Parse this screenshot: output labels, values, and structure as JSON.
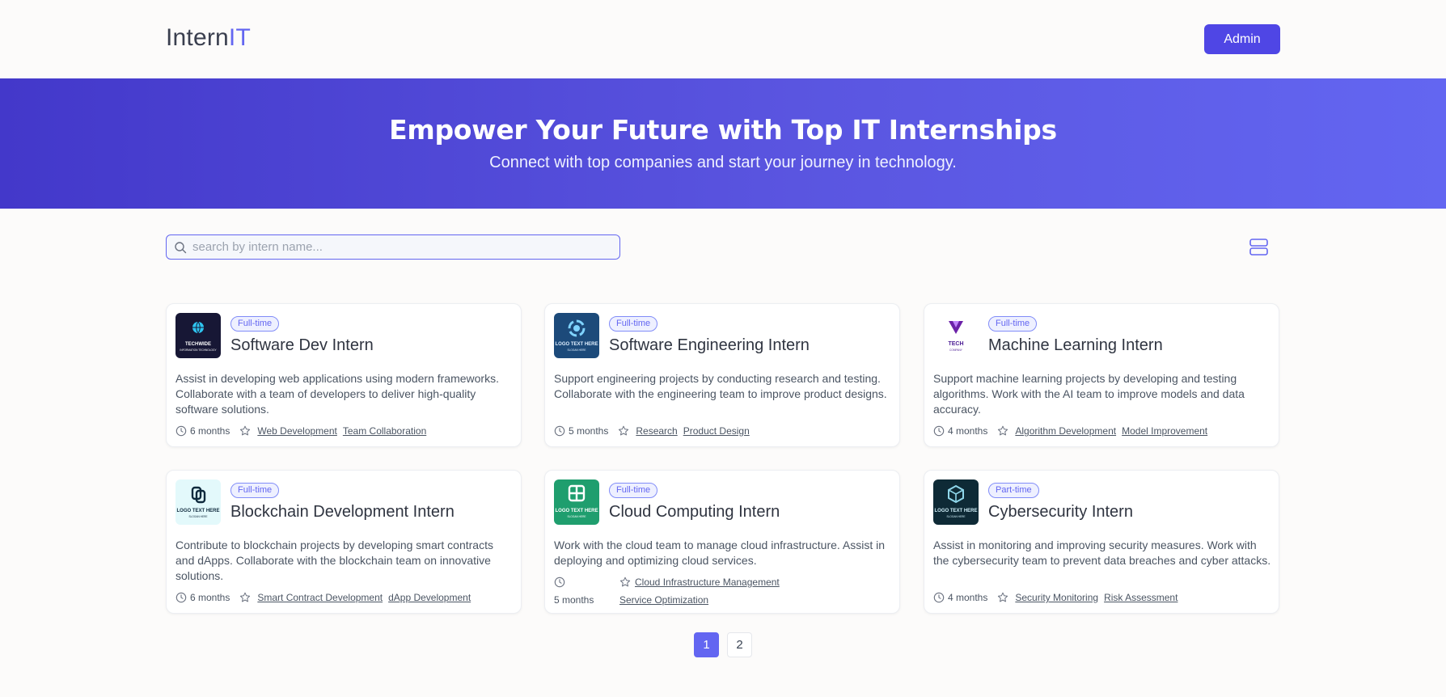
{
  "header": {
    "brand_main": "Intern",
    "brand_accent": "IT",
    "admin_label": "Admin"
  },
  "hero": {
    "title": "Empower Your Future with Top IT Internships",
    "subtitle": "Connect with top companies and start your journey in technology."
  },
  "search": {
    "placeholder": "search by intern name...",
    "value": ""
  },
  "colors": {
    "accent": "#6366f1",
    "primary": "#4f46e5"
  },
  "cards": [
    {
      "type": "Full-time",
      "title": "Software Dev Intern",
      "description": "Assist in developing web applications using modern frameworks. Collaborate with a team of developers to deliver high-quality software solutions.",
      "duration": "6 months",
      "skills": [
        "Web Development",
        "Team Collaboration"
      ],
      "logo_text": "TECHWIDE",
      "logo_sub": "INFORMATION TECHNOLOGY"
    },
    {
      "type": "Full-time",
      "title": "Software Engineering Intern",
      "description": "Support engineering projects by conducting research and testing. Collaborate with the engineering team to improve product designs.",
      "duration": "5 months",
      "skills": [
        "Research",
        "Product Design"
      ],
      "logo_text": "LOGO TEXT HERE",
      "logo_sub": "SLOGAN HERE"
    },
    {
      "type": "Full-time",
      "title": "Machine Learning Intern",
      "description": "Support machine learning projects by developing and testing algorithms. Work with the AI team to improve models and data accuracy.",
      "duration": "4 months",
      "skills": [
        "Algorithm Development",
        "Model Improvement"
      ],
      "logo_text": "TECH",
      "logo_sub": "COMPANY"
    },
    {
      "type": "Full-time",
      "title": "Blockchain Development Intern",
      "description": "Contribute to blockchain projects by developing smart contracts and dApps. Collaborate with the blockchain team on innovative solutions.",
      "duration": "6 months",
      "skills": [
        "Smart Contract Development",
        "dApp Development"
      ],
      "logo_text": "LOGO TEXT HERE",
      "logo_sub": "SLOGAN HERE"
    },
    {
      "type": "Full-time",
      "title": "Cloud Computing Intern",
      "description": "Work with the cloud team to manage cloud infrastructure. Assist in deploying and optimizing cloud services.",
      "duration": "5 months",
      "skills": [
        "Cloud Infrastructure Management",
        "Service Optimization"
      ],
      "logo_text": "LOGO TEXT HERE",
      "logo_sub": "SLOGAN HERE"
    },
    {
      "type": "Part-time",
      "title": "Cybersecurity Intern",
      "description": "Assist in monitoring and improving security measures. Work with the cybersecurity team to prevent data breaches and cyber attacks.",
      "duration": "4 months",
      "skills": [
        "Security Monitoring",
        "Risk Assessment"
      ],
      "logo_text": "LOGO TEXT HERE",
      "logo_sub": "SLOGAN HERE"
    }
  ],
  "pagination": {
    "pages": [
      "1",
      "2"
    ],
    "current": "1"
  }
}
